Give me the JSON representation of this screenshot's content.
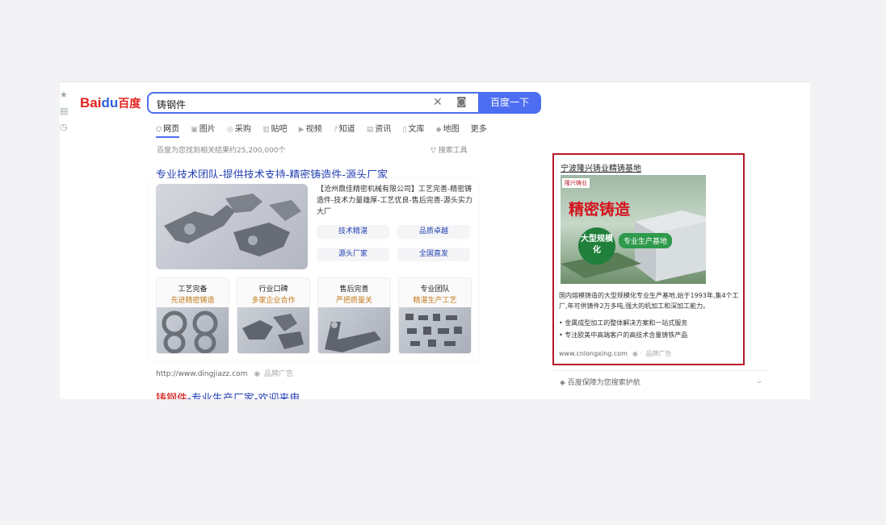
{
  "logo": {
    "text": "Bai",
    "paw": "du",
    "suffix": "百度"
  },
  "search": {
    "query": "铸钢件",
    "button": "百度一下"
  },
  "tabs": [
    {
      "icon": "Q",
      "label": "网页"
    },
    {
      "icon": "▣",
      "label": "图片"
    },
    {
      "icon": "◎",
      "label": "采购"
    },
    {
      "icon": "▥",
      "label": "贴吧"
    },
    {
      "icon": "▶",
      "label": "视频"
    },
    {
      "icon": "?",
      "label": "知道"
    },
    {
      "icon": "▤",
      "label": "资讯"
    },
    {
      "icon": "▯",
      "label": "文库"
    },
    {
      "icon": "◆",
      "label": "地图"
    },
    {
      "icon": "",
      "label": "更多"
    }
  ],
  "result_count": "百度为您找到相关结果约25,200,000个",
  "search_tools": "搜索工具",
  "result1": {
    "title": "专业技术团队-提供技术支持-精密铸造件-源头厂家",
    "description": "【沧州鼎佳精密机械有限公司】工艺完善-精密铸造件-技术力量雄厚-工艺优良-售后完善-源头实力大厂",
    "sublinks": [
      "技术精湛",
      "品质卓越",
      "源头厂家",
      "全国直发"
    ],
    "tiles": [
      {
        "title": "工艺完备",
        "subtitle": "先进精密铸造"
      },
      {
        "title": "行业口碑",
        "subtitle": "多家企业合作"
      },
      {
        "title": "售后完善",
        "subtitle": "严把质量关"
      },
      {
        "title": "专业团队",
        "subtitle": "精湛生产工艺"
      }
    ],
    "url": "http://www.dingjiazz.com",
    "badge": "品牌广告"
  },
  "result2": {
    "title_highlight": "铸钢件",
    "title_rest": "-专业生产厂家-欢迎来电"
  },
  "right_ad": {
    "title": "宁波隆兴铸业精铸基地",
    "brand_tag": "隆兴铸业",
    "banner_main": "精密铸造",
    "banner_circle": "大型规模化",
    "banner_pill": "专业生产基地",
    "description": "国内熔模铸造的大型规模化专业生产基地,始于1993年,集4个工厂,年可供铸件2万多吨,强大的机加工和深加工能力。",
    "bullets": [
      "金属成型加工的整体解决方案和一站式服务",
      "专注欧美中高端客户的高技术含量铸铁产品"
    ],
    "url": "www.cnlongxing.com",
    "badge": "品牌广告"
  },
  "guard": "百度保障为您搜索护航"
}
